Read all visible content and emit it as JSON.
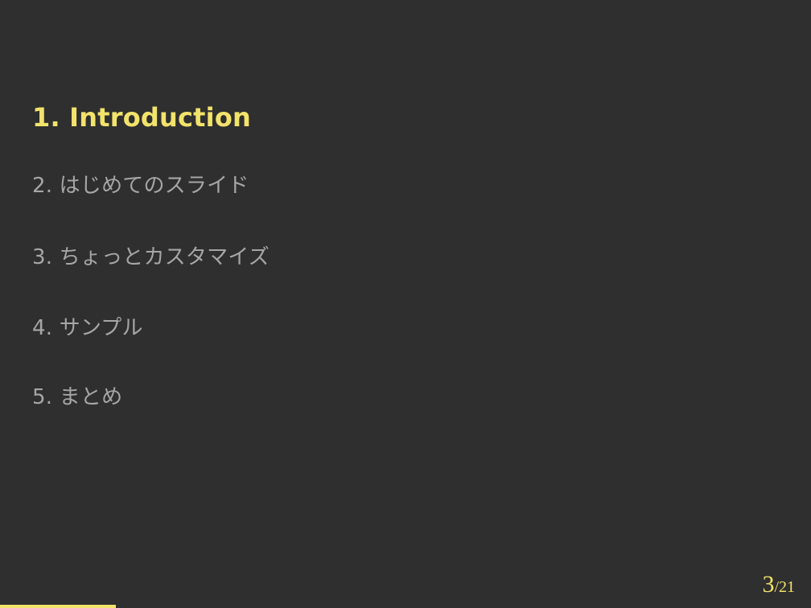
{
  "toc": {
    "items": [
      {
        "label": "1. Introduction",
        "active": true
      },
      {
        "label": "2. はじめてのスライド",
        "active": false
      },
      {
        "label": "3. ちょっとカスタマイズ",
        "active": false
      },
      {
        "label": "4. サンプル",
        "active": false
      },
      {
        "label": "5. まとめ",
        "active": false
      }
    ]
  },
  "pager": {
    "current": "3",
    "separator": "/",
    "total": "21",
    "progress": 0.1428
  },
  "colors": {
    "background": "#2f2f2f",
    "accent": "#f2e36b",
    "muted_text": "#a6a6a6"
  }
}
